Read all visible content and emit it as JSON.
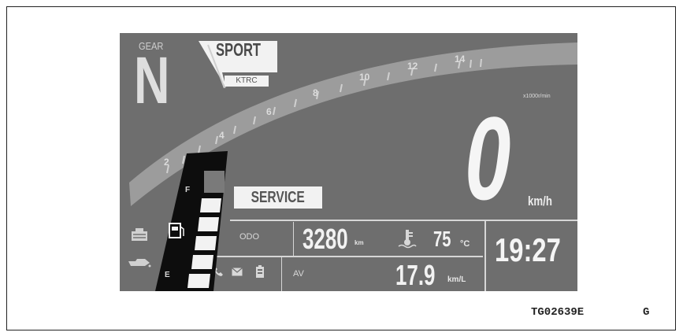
{
  "gear": {
    "label": "GEAR",
    "value": "N"
  },
  "mode": {
    "name": "SPORT",
    "sub": "KTRC"
  },
  "tachometer": {
    "tick_labels": [
      "2",
      "4",
      "6",
      "8",
      "10",
      "12",
      "14"
    ],
    "unit": "x1000r/min"
  },
  "warning": {
    "service": "SERVICE"
  },
  "speed": {
    "value": "0",
    "unit": "km/h"
  },
  "odometer": {
    "label": "ODO",
    "value": "3280",
    "unit": "km"
  },
  "coolant": {
    "value": "75",
    "unit": "°C"
  },
  "fuel_economy": {
    "label": "AV",
    "value": "17.9",
    "unit": "km/L"
  },
  "clock": {
    "time": "19:27"
  },
  "fuel_gauge": {
    "full_label": "F",
    "empty_label": "E",
    "level_fraction": 0.83
  },
  "caption": {
    "code": "TG02639E",
    "suffix": "G"
  },
  "colors": {
    "screen": "#6e6e6e",
    "arc": "#9a9a9a",
    "white": "#f2f2f2",
    "fuel_frame": "#0d0d0d"
  },
  "icons": [
    "engine-warning-icon",
    "oil-icon",
    "fuel-pump-icon",
    "phone-icon",
    "mail-icon",
    "battery-icon",
    "thermometer-icon"
  ]
}
